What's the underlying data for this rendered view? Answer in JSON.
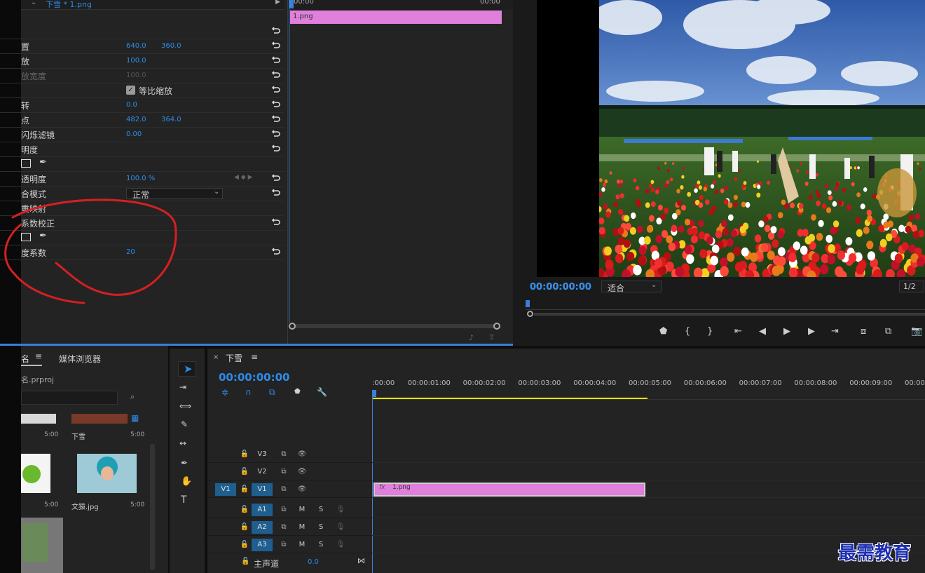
{
  "effect_controls": {
    "source_label": "下雪 * 1.png",
    "timeline_start": "00:00",
    "timeline_end": "00:00",
    "clip_name": "1.png",
    "rows": [
      {
        "label": "",
        "v1": "",
        "v2": ""
      },
      {
        "label": "置",
        "v1": "640.0",
        "v2": "360.0"
      },
      {
        "label": "放",
        "v1": "100.0",
        "v2": ""
      },
      {
        "label": "放宽度",
        "v1": "100.0",
        "v2": ""
      },
      {
        "label": "",
        "v1": "",
        "v2": ""
      },
      {
        "label": "转",
        "v1": "0.0",
        "v2": ""
      },
      {
        "label": "点",
        "v1": "482.0",
        "v2": "364.0"
      },
      {
        "label": "闪烁滤镜",
        "v1": "0.00",
        "v2": ""
      },
      {
        "label": "明度",
        "v1": "",
        "v2": ""
      },
      {
        "label": "",
        "v1": "",
        "v2": ""
      },
      {
        "label": "透明度",
        "v1": "100.0 %",
        "v2": ""
      },
      {
        "label": "合模式",
        "v1": "",
        "v2": ""
      },
      {
        "label": "重映射",
        "v1": "",
        "v2": ""
      },
      {
        "label": "系数校正",
        "v1": "",
        "v2": ""
      },
      {
        "label": "",
        "v1": "",
        "v2": ""
      },
      {
        "label": "度系数",
        "v1": "20",
        "v2": ""
      }
    ],
    "uniform_scale_label": "等比缩放",
    "uniform_scale_checked": true,
    "blend_mode_value": "正常"
  },
  "program": {
    "timecode": "00:00:00:00",
    "fit_value": "适合",
    "resolution": "1/2"
  },
  "project": {
    "tabs": [
      "名",
      "媒体浏览器"
    ],
    "file_name": "名.prproj",
    "items": [
      {
        "name": "",
        "duration": "5:00"
      },
      {
        "name": "下雪",
        "duration": "5:00"
      },
      {
        "name": "",
        "duration": "5:00"
      },
      {
        "name": "文猿.jpg",
        "duration": "5:00"
      }
    ]
  },
  "timeline": {
    "sequence_name": "下雪",
    "timecode": "00:00:00:00",
    "ruler": [
      ":00:00",
      "00:00:01:00",
      "00:00:02:00",
      "00:00:03:00",
      "00:00:04:00",
      "00:00:05:00",
      "00:00:06:00",
      "00:00:07:00",
      "00:00:08:00",
      "00:00:09:00",
      "00:00"
    ],
    "video_tracks": [
      "V3",
      "V2",
      "V1"
    ],
    "source_v1": "V1",
    "audio_tracks": [
      "A1",
      "A2",
      "A3"
    ],
    "mute_label": "M",
    "solo_label": "S",
    "master_label": "主声道",
    "master_value": "0.0",
    "clip_name": "1.png",
    "clip_fx": "fx"
  },
  "watermark": "最需教育",
  "colors": {
    "accent": "#2d8ceb",
    "clip": "#e07fdc",
    "annotation": "#d42020",
    "playhead": "#3a7fd8",
    "work_area": "#e6e600"
  }
}
